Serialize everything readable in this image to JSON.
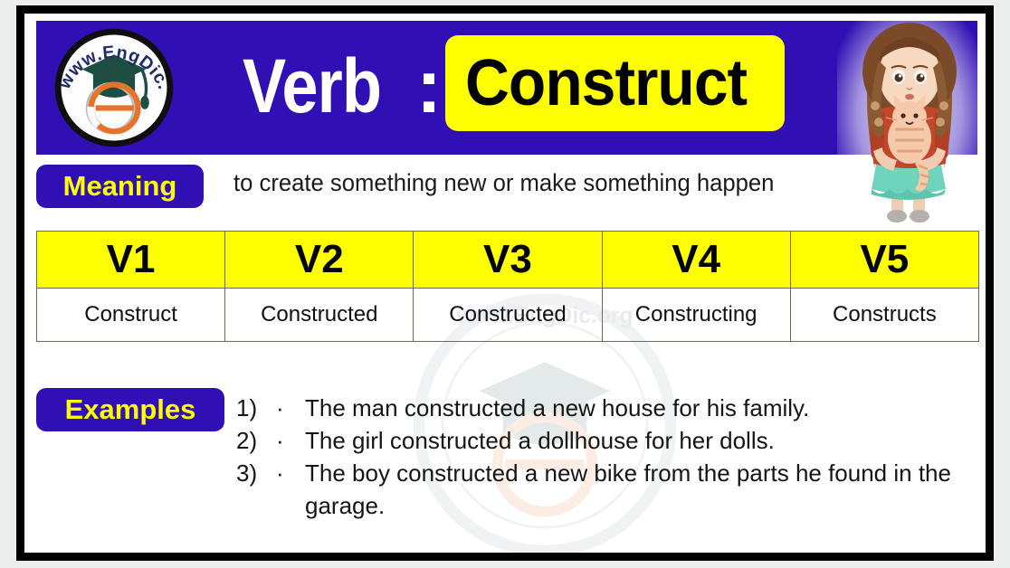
{
  "colors": {
    "brand_blue": "#3010b4",
    "accent_yellow": "#ffff00",
    "frame_black": "#000000",
    "cell_border": "#6b6b55",
    "text_black": "#111111",
    "logo_orange": "#e8722a",
    "logo_green": "#1e4d43"
  },
  "header": {
    "logo_text": "www.EngDic.org",
    "logo_icon": "graduation-cap-e-logo",
    "part_of_speech": "Verb",
    "separator": ":",
    "word": "Construct",
    "illustration": "girl-holding-cat-illustration"
  },
  "meaning": {
    "label": "Meaning",
    "text": "to create something new or make something happen"
  },
  "verb_table": {
    "headers": [
      "V1",
      "V2",
      "V3",
      "V4",
      "V5"
    ],
    "forms": [
      "Construct",
      "Constructed",
      "Constructed",
      "Constructing",
      "Constructs"
    ]
  },
  "examples": {
    "label": "Examples",
    "items": [
      {
        "number": "1)",
        "bullet": "·",
        "text": "The man constructed a new house for his family."
      },
      {
        "number": "2)",
        "bullet": "·",
        "text": "The girl constructed a dollhouse for her dolls."
      },
      {
        "number": "3)",
        "bullet": "·",
        "text": "The boy constructed a new bike from the parts he found in the garage."
      }
    ]
  },
  "watermark": {
    "text": "www.EngDic.org"
  }
}
